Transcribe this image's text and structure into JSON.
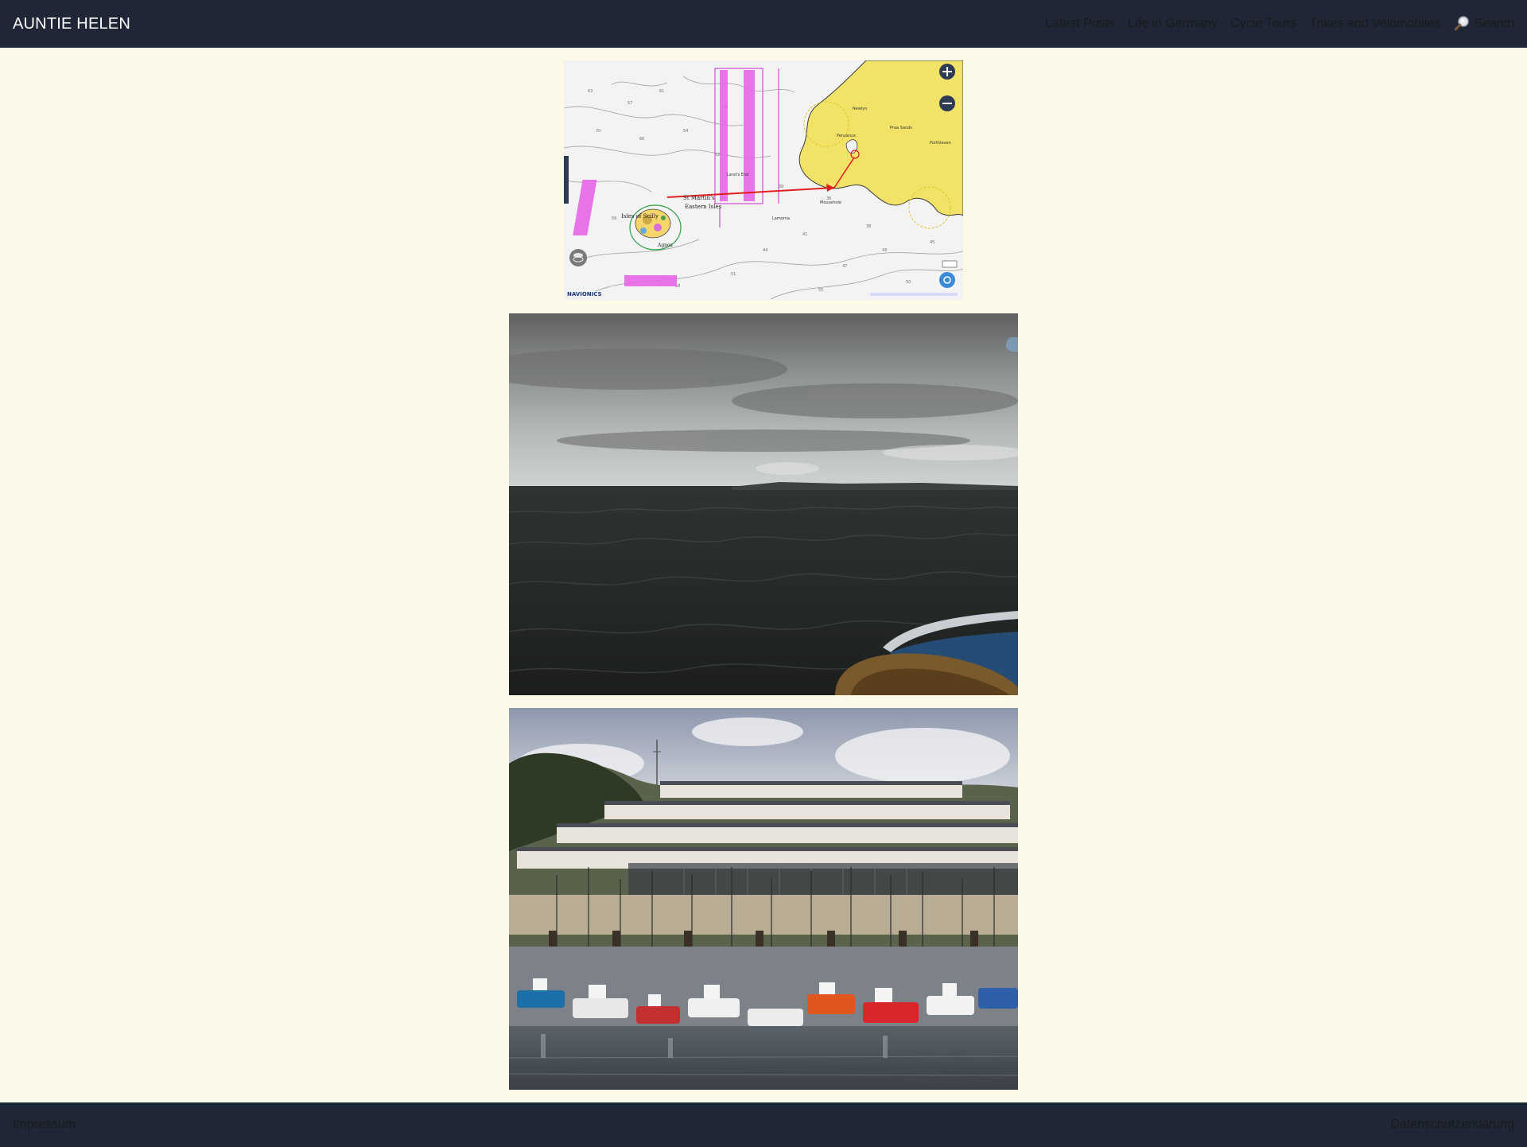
{
  "header": {
    "brand": "AUNTIE HELEN",
    "nav": [
      "Latest Posts",
      "Life in Germany",
      "Cycle Tours",
      "Trikes and Velomobiles"
    ],
    "search_label": "Search"
  },
  "images": [
    {
      "kind": "nautical-chart",
      "labels": [
        "Isles of Scilly",
        "St Martin's",
        "Eastern Isles",
        "Agnes",
        "Penzance",
        "Praa Sands",
        "Porthleven",
        "Newlyn",
        "Mousehole",
        "Lamorna",
        "Land's End",
        "NAVIONICS"
      ]
    },
    {
      "kind": "photo-open-sea"
    },
    {
      "kind": "photo-harbour-fishing-boats"
    }
  ],
  "footer": {
    "left_link": "Impressum",
    "right_link": "Datenschutzerklärung"
  },
  "colors": {
    "bar": "#1f2737",
    "page": "#fdf9e8",
    "brand_text": "#ffffff",
    "link_text": "#1a1a1a"
  }
}
